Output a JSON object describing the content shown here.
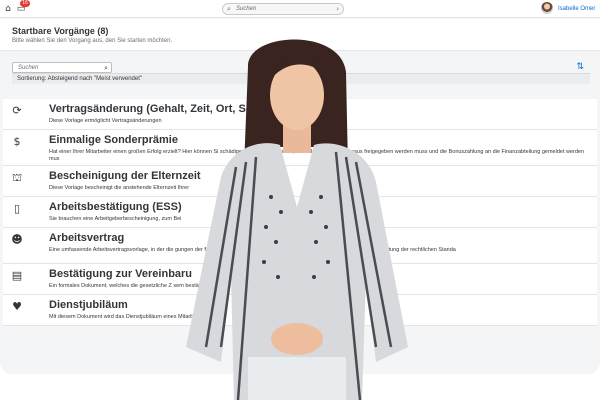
{
  "shell": {
    "notification_count": "16",
    "search_placeholder": "Suchen",
    "user_name": "Isabelle Omer"
  },
  "header": {
    "title": "Startbare Vorgänge (8)",
    "subtitle": "Bitte wählen Sie den Vorgang aus, den Sie starten möchten."
  },
  "toolbar": {
    "search_placeholder": "Suchen",
    "sort_info": "Sortierung: Absteigend nach \"Meist verwendet\""
  },
  "items": [
    {
      "icon": "money-exchange-icon",
      "title": "Vertragsänderung (Gehalt, Zeit, Ort, Sonsti",
      "desc": "Diese Vorlage ermöglicht Vertragsänderungen"
    },
    {
      "icon": "dollar-circle-icon",
      "title": "Einmalige Sonderprämie",
      "desc": "Hat einer Ihrer Mitarbeiter einen großen Erfolg erzielt? Hier können Si                                                                                                    schädigen. Bitte beachten Sie, dass das Budget im Voraus freigegeben werden muss und die Bonuszahlung an die Finanzabteilung gemeldet werden mus"
    },
    {
      "icon": "family-icon",
      "title": "Bescheinigung der Elternzeit",
      "desc": "Diese Vorlage bescheinigt die anstehende Elternzeit Ihrer"
    },
    {
      "icon": "document-icon",
      "title": "Arbeitsbestätigung (ESS)",
      "desc": "Sie brauchen eine Arbeitgeberbescheinigung, zum Bei"
    },
    {
      "icon": "group-icon",
      "title": "Arbeitsvertrag",
      "desc": "Eine umfassende Arbeitsvertragsvorlage, in der die                                                                                                    gungen der Mitarbeiter detailliert aufgeführt sind, um Klarheit zu schaffen und die Einhaltung der rechtlichen Standa"
    },
    {
      "icon": "book-icon",
      "title": "Bestätigung zur Vereinbaru",
      "desc": "Ein formales Dokument, welches die gesetzliche Z                                                                                                    sem bestätigt."
    },
    {
      "icon": "heart-icon",
      "title": "Dienstjubiläum",
      "desc": "Mit diesem Dokument wird das Dienstjubiläum eines Mitarbeiters, se"
    }
  ]
}
